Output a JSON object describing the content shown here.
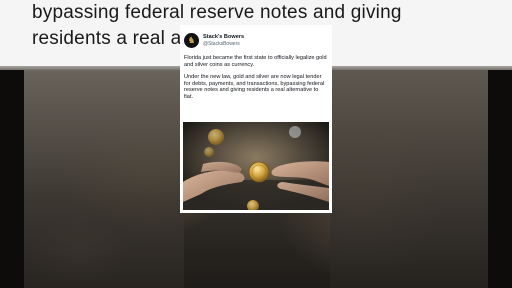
{
  "background": {
    "caption_line1": "bypassing federal reserve notes and giving",
    "caption_line2": "residents a real alternative to fiat."
  },
  "tweet": {
    "display_name": "Stack's Bowers",
    "handle": "@StacksBowers",
    "paragraph1": "Florida just became the first state to officially legalize gold and silver coins as currency.",
    "paragraph2": "Under the new law, gold and silver are now legal tender for debts, payments, and transactions, bypassing federal reserve notes and giving residents a real alternative to fiat.",
    "avatar_icon": "minuteman-icon",
    "photo": "hands-holding-gold-coin"
  },
  "colors": {
    "card": "#ffffff",
    "text": "#0f1419",
    "handle": "#536471",
    "gold": "#c9a34b"
  }
}
